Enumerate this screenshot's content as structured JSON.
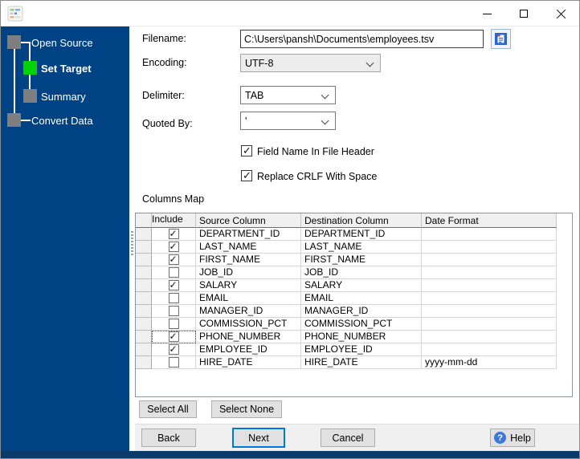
{
  "window": {
    "icons": {
      "app": "app-grid-icon",
      "minimize": "minimize-icon",
      "maximize": "maximize-icon",
      "close": "close-icon",
      "browse": "document-icon",
      "combo_arrow": "chevron-down-icon",
      "help": "question-circle-icon",
      "check": "✓"
    }
  },
  "sidebar": {
    "background": "#004384",
    "active_color": "#00d300",
    "inactive_color": "#7f7f7f",
    "steps": [
      {
        "label": "Open Source",
        "state": "inactive"
      },
      {
        "label": "Set Target",
        "state": "active"
      },
      {
        "label": "Summary",
        "state": "inactive"
      },
      {
        "label": "Convert Data",
        "state": "inactive"
      }
    ]
  },
  "form": {
    "filename": {
      "label": "Filename:",
      "value": "C:\\Users\\pansh\\Documents\\employees.tsv"
    },
    "encoding": {
      "label": "Encoding:",
      "value": "UTF-8"
    },
    "delimiter": {
      "label": "Delimiter:",
      "value": "TAB"
    },
    "quoted_by": {
      "label": "Quoted By:",
      "value": "'"
    },
    "checkboxes": [
      {
        "label": "Field Name In File Header",
        "checked": true
      },
      {
        "label": "Replace CRLF With Space",
        "checked": true
      }
    ],
    "section_label": "Columns Map"
  },
  "table": {
    "headers": {
      "include": "Include",
      "source": "Source Column",
      "destination": "Destination Column",
      "date_format": "Date Format"
    },
    "rows": [
      {
        "include": true,
        "source": "DEPARTMENT_ID",
        "destination": "DEPARTMENT_ID",
        "date_format": ""
      },
      {
        "include": true,
        "source": "LAST_NAME",
        "destination": "LAST_NAME",
        "date_format": ""
      },
      {
        "include": true,
        "source": "FIRST_NAME",
        "destination": "FIRST_NAME",
        "date_format": ""
      },
      {
        "include": false,
        "source": "JOB_ID",
        "destination": "JOB_ID",
        "date_format": ""
      },
      {
        "include": true,
        "source": "SALARY",
        "destination": "SALARY",
        "date_format": ""
      },
      {
        "include": false,
        "source": "EMAIL",
        "destination": "EMAIL",
        "date_format": ""
      },
      {
        "include": false,
        "source": "MANAGER_ID",
        "destination": "MANAGER_ID",
        "date_format": ""
      },
      {
        "include": false,
        "source": "COMMISSION_PCT",
        "destination": "COMMISSION_PCT",
        "date_format": ""
      },
      {
        "include": true,
        "source": "PHONE_NUMBER",
        "destination": "PHONE_NUMBER",
        "date_format": "",
        "focused": true
      },
      {
        "include": true,
        "source": "EMPLOYEE_ID",
        "destination": "EMPLOYEE_ID",
        "date_format": ""
      },
      {
        "include": false,
        "source": "HIRE_DATE",
        "destination": "HIRE_DATE",
        "date_format": "yyyy-mm-dd"
      }
    ]
  },
  "buttons": {
    "select_all": "Select All",
    "select_none": "Select None",
    "back": "Back",
    "next": "Next",
    "cancel": "Cancel",
    "help": "Help"
  },
  "colors": {
    "accent_focus": "#0078d7",
    "help_icon": "#3c78dc",
    "focus_cell_border": "#d40000",
    "footer_strip": "#0a3a69"
  }
}
